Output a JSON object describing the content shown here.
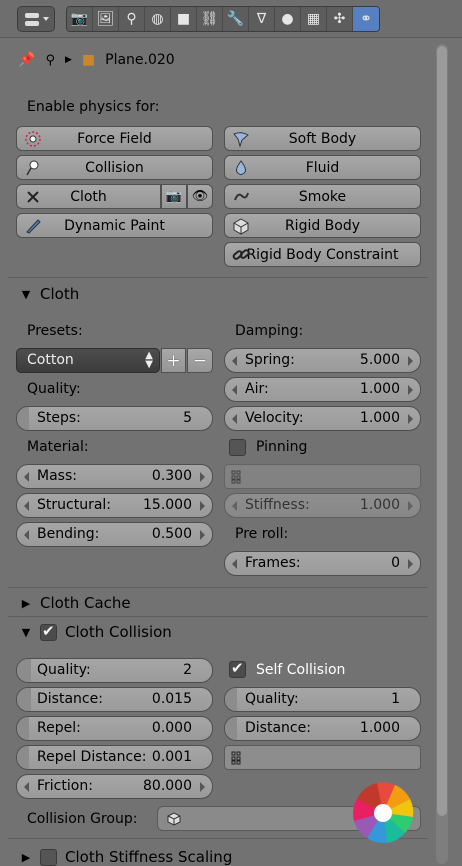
{
  "header": {
    "tabs": [
      {
        "icon": "render-icon",
        "glyph": "📷"
      },
      {
        "icon": "render-layers-icon",
        "glyph": "🖼"
      },
      {
        "icon": "scene-icon",
        "glyph": "⚲"
      },
      {
        "icon": "world-icon",
        "glyph": "◍"
      },
      {
        "icon": "object-icon",
        "glyph": "■"
      },
      {
        "icon": "constraints-icon",
        "glyph": "⛓"
      },
      {
        "icon": "modifiers-icon",
        "glyph": "🔧"
      },
      {
        "icon": "data-icon",
        "glyph": "∇"
      },
      {
        "icon": "material-icon",
        "glyph": "●"
      },
      {
        "icon": "texture-icon",
        "glyph": "▦"
      },
      {
        "icon": "particles-icon",
        "glyph": "✣"
      },
      {
        "icon": "physics-icon",
        "glyph": "⚭"
      }
    ],
    "active_tab": "physics-icon"
  },
  "path": {
    "object_name": "Plane.020"
  },
  "enable_physics": {
    "label": "Enable physics for:",
    "left": [
      "Force Field",
      "Collision",
      "Cloth",
      "Dynamic Paint"
    ],
    "right": [
      "Soft Body",
      "Fluid",
      "Smoke",
      "Rigid Body",
      "Rigid Body Constraint"
    ]
  },
  "cloth": {
    "title": "Cloth",
    "presets_label": "Presets:",
    "preset_value": "Cotton",
    "quality_label": "Quality:",
    "steps": {
      "label": "Steps:",
      "value": "5"
    },
    "material_label": "Material:",
    "mass": {
      "label": "Mass:",
      "value": "0.300"
    },
    "structural": {
      "label": "Structural:",
      "value": "15.000"
    },
    "bending": {
      "label": "Bending:",
      "value": "0.500"
    },
    "damping_label": "Damping:",
    "spring": {
      "label": "Spring:",
      "value": "5.000"
    },
    "air": {
      "label": "Air:",
      "value": "1.000"
    },
    "velocity": {
      "label": "Velocity:",
      "value": "1.000"
    },
    "pinning_label": "Pinning",
    "stiffness": {
      "label": "Stiffness:",
      "value": "1.000"
    },
    "preroll_label": "Pre roll:",
    "frames": {
      "label": "Frames:",
      "value": "0"
    }
  },
  "cloth_cache": {
    "title": "Cloth Cache"
  },
  "cloth_collision": {
    "title": "Cloth Collision",
    "enabled": true,
    "quality": {
      "label": "Quality:",
      "value": "2"
    },
    "distance": {
      "label": "Distance:",
      "value": "0.015"
    },
    "repel": {
      "label": "Repel:",
      "value": "0.000"
    },
    "repel_distance": {
      "label": "Repel Distance:",
      "value": "0.001"
    },
    "friction": {
      "label": "Friction:",
      "value": "80.000"
    },
    "self_collision_label": "Self Collision",
    "self_collision_enabled": true,
    "self_quality": {
      "label": "Quality:",
      "value": "1"
    },
    "self_distance": {
      "label": "Distance:",
      "value": "1.000"
    },
    "collision_group_label": "Collision Group:"
  },
  "cloth_stiffness": {
    "title": "Cloth Stiffness Scaling",
    "enabled": false
  },
  "colors": {
    "accent": "#5680c2",
    "panel": "#727272",
    "button": "#a0a0a0"
  }
}
